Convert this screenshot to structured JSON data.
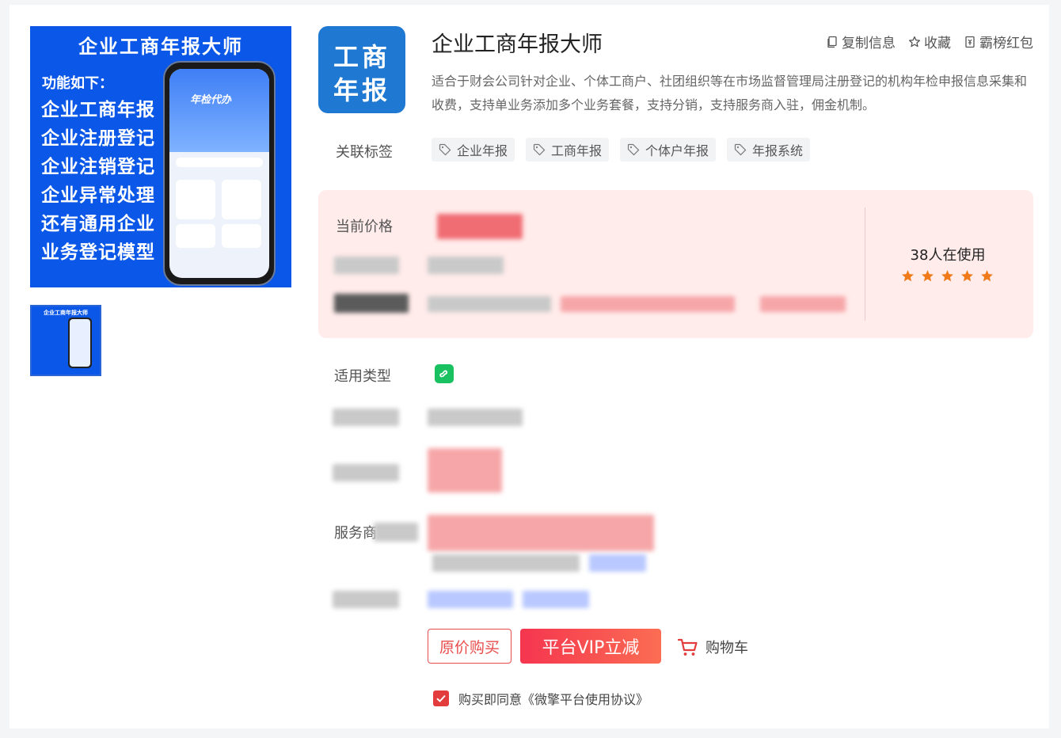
{
  "product": {
    "title": "企业工商年报大师",
    "description": "适合于财会公司针对企业、个体工商户、社团组织等在市场监督管理局注册登记的机构年检申报信息采集和收费，支持单业务添加多个业务套餐，支持分销，支持服务商入驻，佣金机制。",
    "logo_line1": "工商",
    "logo_line2": "年报"
  },
  "image": {
    "banner": "企业工商年报大师",
    "subtitle": "功能如下：",
    "lines": [
      "企业工商年报",
      "企业注册登记",
      "企业注销登记",
      "企业异常处理",
      "还有通用企业",
      "业务登记模型"
    ],
    "phone_text": "年检代办"
  },
  "actions": {
    "copy": "复制信息",
    "favorite": "收藏",
    "ranking": "霸榜红包"
  },
  "labels": {
    "tags": "关联标签",
    "price": "当前价格",
    "type": "适用类型",
    "service": "服务商"
  },
  "tags": [
    "企业年报",
    "工商年报",
    "个体户年报",
    "年报系统"
  ],
  "users": "38人在使用",
  "rating": {
    "stars": 5
  },
  "buttons": {
    "original": "原价购买",
    "vip": "平台VIP立减",
    "cart": "购物车"
  },
  "agreement": "购买即同意《微擎平台使用协议》",
  "colors": {
    "accent": "#e94c4c",
    "mini_program": "#19c160",
    "star": "#f07a1a"
  }
}
